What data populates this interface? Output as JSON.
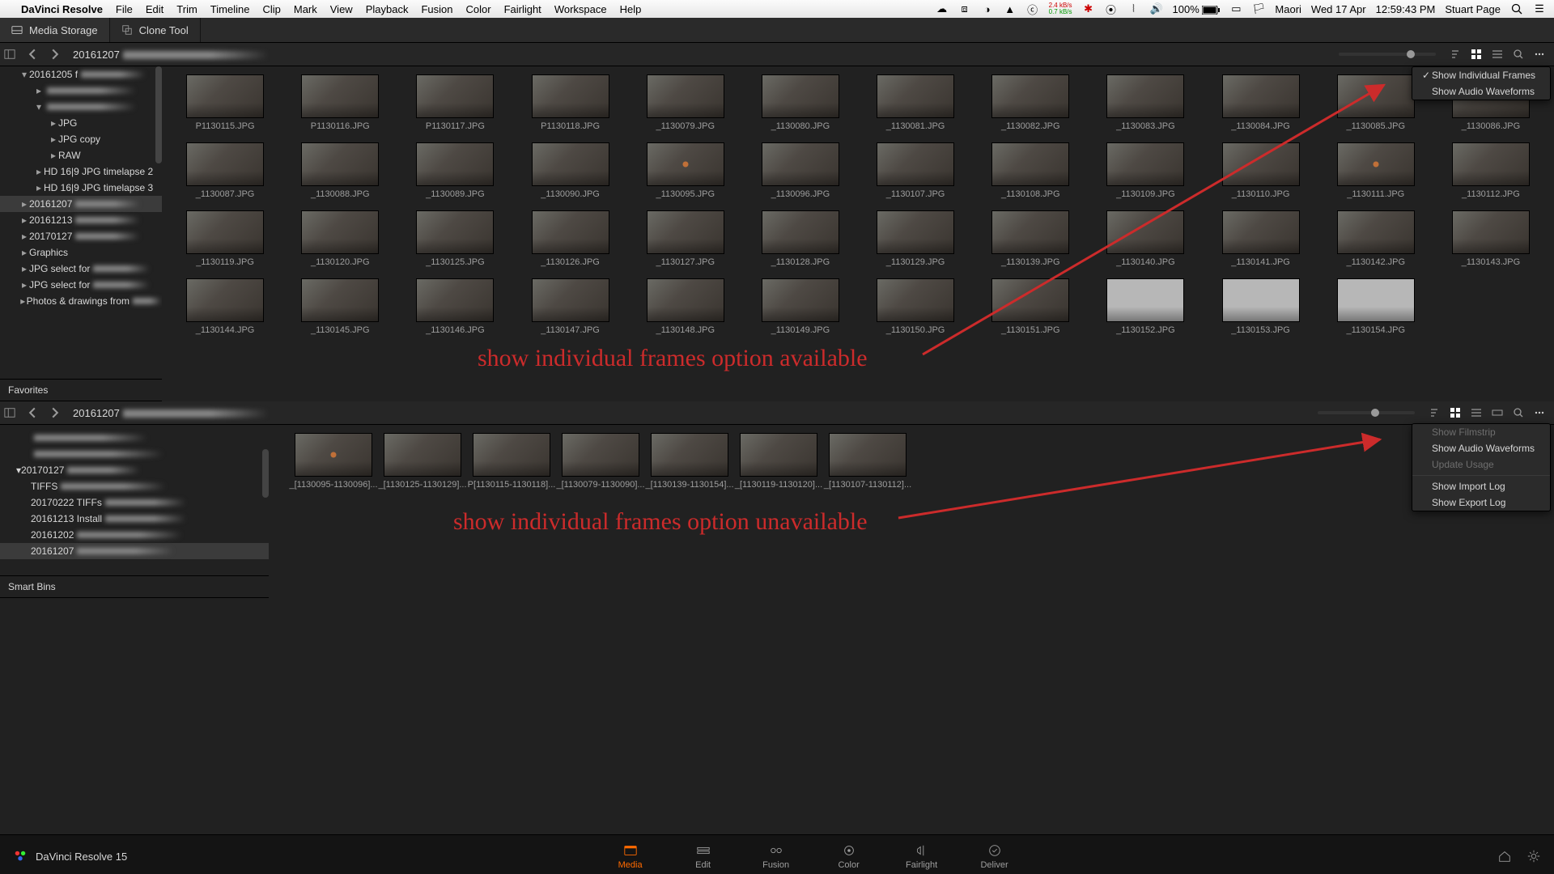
{
  "mac_menubar": {
    "app": "DaVinci Resolve",
    "menus": [
      "File",
      "Edit",
      "Trim",
      "Timeline",
      "Clip",
      "Mark",
      "View",
      "Playback",
      "Fusion",
      "Color",
      "Fairlight",
      "Workspace",
      "Help"
    ],
    "net_up": "2.4 kB/s",
    "net_dn": "0.7 kB/s",
    "battery": "100%",
    "lang": "Maori",
    "date": "Wed 17 Apr",
    "time": "12:59:43 PM",
    "user": "Stuart Page"
  },
  "app_toolbar": {
    "media_storage": "Media Storage",
    "clone_tool": "Clone Tool"
  },
  "upper_panel": {
    "breadcrumb": "20161207",
    "zoom_pos_pct": 70,
    "menu": {
      "show_individual_frames": "Show Individual Frames",
      "show_audio_waveforms": "Show Audio Waveforms",
      "show_individual_frames_checked": true
    },
    "sidebar": [
      {
        "label": "20161205 f",
        "depth": 1,
        "arrow": "down",
        "smudge": 80
      },
      {
        "label": "",
        "depth": 2,
        "arrow": "right",
        "smudge": 110
      },
      {
        "label": "",
        "depth": 2,
        "arrow": "down",
        "smudge": 110
      },
      {
        "label": "JPG",
        "depth": 3,
        "arrow": "right"
      },
      {
        "label": "JPG copy",
        "depth": 3,
        "arrow": "right"
      },
      {
        "label": "RAW",
        "depth": 3,
        "arrow": "right"
      },
      {
        "label": "HD 16|9 JPG timelapse 2",
        "depth": 2,
        "arrow": "right"
      },
      {
        "label": "HD 16|9 JPG timelapse 3",
        "depth": 2,
        "arrow": "right"
      },
      {
        "label": "20161207",
        "depth": 1,
        "arrow": "right",
        "selected": true,
        "smudge": 80
      },
      {
        "label": "20161213",
        "depth": 1,
        "arrow": "right",
        "smudge": 80
      },
      {
        "label": "20170127",
        "depth": 1,
        "arrow": "right",
        "smudge": 80
      },
      {
        "label": "Graphics",
        "depth": 1,
        "arrow": "right"
      },
      {
        "label": "JPG select for",
        "depth": 1,
        "arrow": "right",
        "smudge": 70
      },
      {
        "label": "JPG select for",
        "depth": 1,
        "arrow": "right",
        "smudge": 70
      },
      {
        "label": "Photos & drawings from",
        "depth": 1,
        "arrow": "right",
        "smudge": 50
      }
    ],
    "favorites_header": "Favorites",
    "thumbs": [
      {
        "f": "P1130115.JPG"
      },
      {
        "f": "P1130116.JPG"
      },
      {
        "f": "P1130117.JPG"
      },
      {
        "f": "P1130118.JPG"
      },
      {
        "f": "_1130079.JPG"
      },
      {
        "f": "_1130080.JPG"
      },
      {
        "f": "_1130081.JPG"
      },
      {
        "f": "_1130082.JPG"
      },
      {
        "f": "_1130083.JPG"
      },
      {
        "f": "_1130084.JPG"
      },
      {
        "f": "_1130085.JPG"
      },
      {
        "f": "_1130086.JPG"
      },
      {
        "f": "_1130087.JPG"
      },
      {
        "f": "_1130088.JPG"
      },
      {
        "f": "_1130089.JPG"
      },
      {
        "f": "_1130090.JPG"
      },
      {
        "f": "_1130095.JPG",
        "spot": true
      },
      {
        "f": "_1130096.JPG"
      },
      {
        "f": "_1130107.JPG"
      },
      {
        "f": "_1130108.JPG"
      },
      {
        "f": "_1130109.JPG"
      },
      {
        "f": "_1130110.JPG"
      },
      {
        "f": "_1130111.JPG",
        "spot": true
      },
      {
        "f": "_1130112.JPG"
      },
      {
        "f": "_1130119.JPG"
      },
      {
        "f": "_1130120.JPG"
      },
      {
        "f": "_1130125.JPG"
      },
      {
        "f": "_1130126.JPG"
      },
      {
        "f": "_1130127.JPG"
      },
      {
        "f": "_1130128.JPG"
      },
      {
        "f": "_1130129.JPG"
      },
      {
        "f": "_1130139.JPG"
      },
      {
        "f": "_1130140.JPG"
      },
      {
        "f": "_1130141.JPG"
      },
      {
        "f": "_1130142.JPG"
      },
      {
        "f": "_1130143.JPG"
      },
      {
        "f": "_1130144.JPG"
      },
      {
        "f": "_1130145.JPG"
      },
      {
        "f": "_1130146.JPG"
      },
      {
        "f": "_1130147.JPG"
      },
      {
        "f": "_1130148.JPG"
      },
      {
        "f": "_1130149.JPG"
      },
      {
        "f": "_1130150.JPG"
      },
      {
        "f": "_1130151.JPG"
      },
      {
        "f": "_1130152.JPG",
        "grey": true
      },
      {
        "f": "_1130153.JPG",
        "grey": true
      },
      {
        "f": "_1130154.JPG",
        "grey": true
      }
    ]
  },
  "lower_panel": {
    "breadcrumb": "20161207",
    "zoom_pos_pct": 55,
    "menu": {
      "show_filmstrip": "Show Filmstrip",
      "show_audio_waveforms": "Show Audio Waveforms",
      "update_usage": "Update Usage",
      "show_import_log": "Show Import Log",
      "show_export_log": "Show Export Log"
    },
    "bins": [
      {
        "label": "",
        "depth": 1,
        "smudge": 140
      },
      {
        "label": "",
        "depth": 1,
        "smudge": 160
      },
      {
        "label": "20170127",
        "depth": 0,
        "arrow": "down",
        "smudge": 90
      },
      {
        "label": "TIFFS",
        "depth": 1,
        "smudge": 130
      },
      {
        "label": "20170222 TIFFs",
        "depth": 1,
        "smudge": 100
      },
      {
        "label": "20161213 Install",
        "depth": 1,
        "smudge": 100
      },
      {
        "label": "20161202",
        "depth": 1,
        "smudge": 130
      },
      {
        "label": "20161207",
        "depth": 1,
        "selected": true,
        "smudge": 120
      }
    ],
    "smart_bins_header": "Smart Bins",
    "thumbs": [
      {
        "f": "_[1130095-1130096]...",
        "spot": true
      },
      {
        "f": "_[1130125-1130129]..."
      },
      {
        "f": "P[1130115-1130118]..."
      },
      {
        "f": "_[1130079-1130090]..."
      },
      {
        "f": "_[1130139-1130154]..."
      },
      {
        "f": "_[1130119-1130120]..."
      },
      {
        "f": "_[1130107-1130112]..."
      }
    ]
  },
  "annotations": {
    "upper": "show individual frames option available",
    "lower": "show individual frames option unavailable"
  },
  "page_nav": {
    "project": "DaVinci Resolve 15",
    "pages": [
      "Media",
      "Edit",
      "Fusion",
      "Color",
      "Fairlight",
      "Deliver"
    ],
    "active": "Media"
  }
}
